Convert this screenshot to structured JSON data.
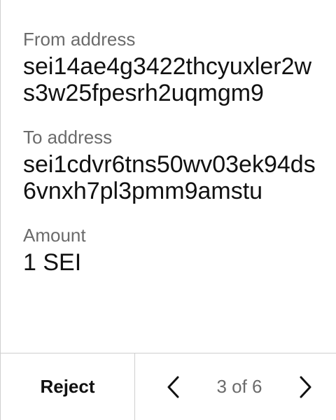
{
  "fields": [
    {
      "label": "From address",
      "value": "sei14ae4g3422thcyuxler2ws3w25fpesrh2uqmgm9"
    },
    {
      "label": "To address",
      "value": "sei1cdvr6tns50wv03ek94ds6vnxh7pl3pmm9amstu"
    },
    {
      "label": "Amount",
      "value": "1 SEI"
    }
  ],
  "footer": {
    "reject_label": "Reject",
    "page_indicator": "3 of 6",
    "prev_icon": "chevron-left-icon",
    "next_icon": "chevron-right-icon"
  },
  "colors": {
    "label": "#6b6b6b",
    "value": "#111111",
    "divider": "#cfcfcf",
    "background": "#ffffff"
  }
}
